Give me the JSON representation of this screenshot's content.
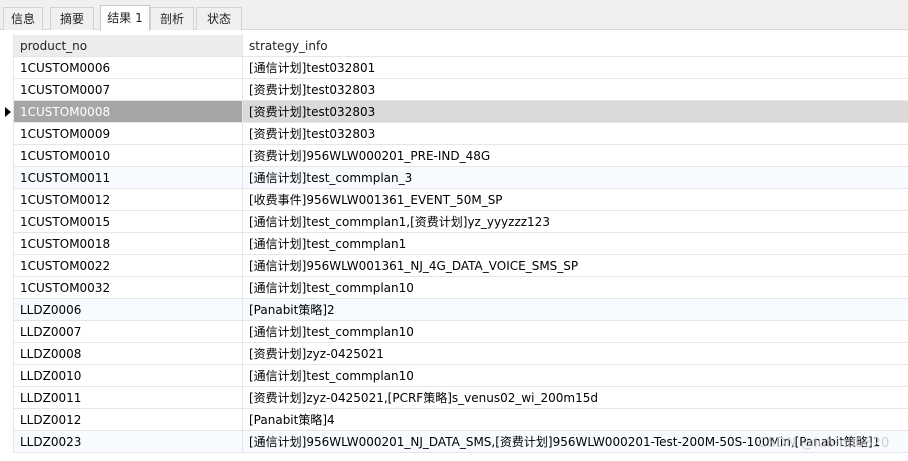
{
  "tabs": [
    {
      "label": "信息",
      "active": false
    },
    {
      "label": "摘要",
      "active": false
    },
    {
      "label": "结果 1",
      "active": true
    },
    {
      "label": "剖析",
      "active": false
    },
    {
      "label": "状态",
      "active": false
    }
  ],
  "grid": {
    "columns": [
      "product_no",
      "strategy_info"
    ],
    "rows": [
      [
        "1CUSTOM0006",
        "[通信计划]test032801"
      ],
      [
        "1CUSTOM0007",
        "[资费计划]test032803"
      ],
      [
        "1CUSTOM0008",
        "[资费计划]test032803"
      ],
      [
        "1CUSTOM0009",
        "[资费计划]test032803"
      ],
      [
        "1CUSTOM0010",
        "[资费计划]956WLW000201_PRE-IND_48G"
      ],
      [
        "1CUSTOM0011",
        "[通信计划]test_commplan_3"
      ],
      [
        "1CUSTOM0012",
        "[收费事件]956WLW001361_EVENT_50M_SP"
      ],
      [
        "1CUSTOM0015",
        "[通信计划]test_commplan1,[资费计划]yz_yyyzzz123"
      ],
      [
        "1CUSTOM0018",
        "[通信计划]test_commplan1"
      ],
      [
        "1CUSTOM0022",
        "[通信计划]956WLW001361_NJ_4G_DATA_VOICE_SMS_SP"
      ],
      [
        "1CUSTOM0032",
        "[通信计划]test_commplan10"
      ],
      [
        "LLDZ0006",
        "[Panabit策略]2"
      ],
      [
        "LLDZ0007",
        "[通信计划]test_commplan10"
      ],
      [
        "LLDZ0008",
        "[资费计划]zyz-0425021"
      ],
      [
        "LLDZ0010",
        "[通信计划]test_commplan10"
      ],
      [
        "LLDZ0011",
        "[资费计划]zyz-0425021,[PCRF策略]s_venus02_wi_200m15d"
      ],
      [
        "LLDZ0012",
        "[Panabit策略]4"
      ],
      [
        "LLDZ0023",
        "[通信计划]956WLW000201_NJ_DATA_SMS,[资费计划]956WLW000201-Test-200M-50S-100Min,[Panabit策略]1"
      ]
    ],
    "selected_row_index": 2
  },
  "watermark": "CSDN @lubinii0620"
}
